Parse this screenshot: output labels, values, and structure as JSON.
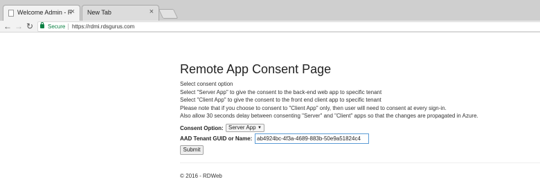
{
  "browser": {
    "tabs": [
      {
        "title": "Welcome Admin - RDWe",
        "active": true
      },
      {
        "title": "New Tab",
        "active": false
      }
    ],
    "close_glyph": "×",
    "address": {
      "secure_label": "Secure",
      "url": "https://rdmi.rdsgurus.com"
    },
    "icons": {
      "back": "back-arrow-icon",
      "forward": "forward-arrow-icon",
      "reload": "reload-icon",
      "lock": "lock-icon",
      "favicon": "page-favicon-icon"
    },
    "colors": {
      "secure": "#0b8043"
    }
  },
  "page": {
    "title": "Remote App Consent Page",
    "lines": [
      "Select consent option",
      "Select \"Server App\" to give the consent to the back-end web app to specific tenant",
      "Select \"Client App\" to give the consent to the front end client app to specific tenant",
      "Please note that if you choose to consent to \"Client App\" only, then user will need to consent at every sign-in.",
      "Also allow 30 seconds delay between consenting \"Server\" and \"Client\" apps so that the changes are propagated in Azure."
    ],
    "form": {
      "consent_label": "Consent Option:",
      "consent_value": "Server App",
      "tenant_label": "AAD Tenant GUID or Name:",
      "tenant_value": "ab4924bc-4f3a-4689-883b-50e9a51824c4",
      "submit_label": "Submit"
    },
    "footer": "© 2016 - RDWeb"
  }
}
